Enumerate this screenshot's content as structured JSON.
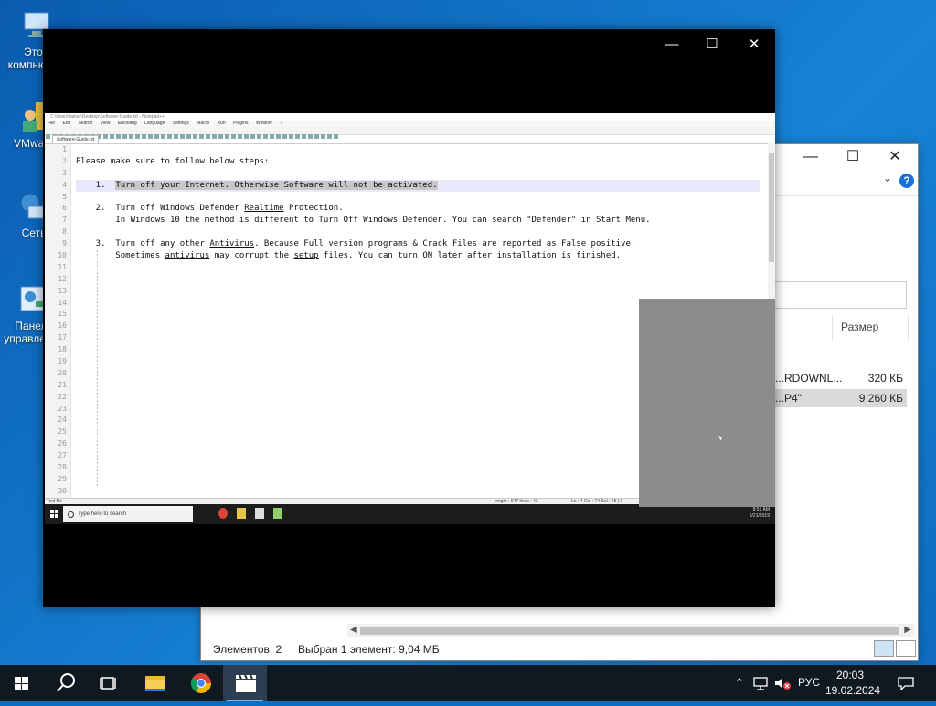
{
  "desktop": {
    "icons": [
      {
        "name": "this-pc",
        "label1": "Этот",
        "label2": "компьютер"
      },
      {
        "name": "vmware",
        "label1": "VMware",
        "label2": ""
      },
      {
        "name": "network",
        "label1": "Сеть",
        "label2": ""
      },
      {
        "name": "control-panel",
        "label1": "Панель",
        "label2": "управления"
      }
    ]
  },
  "explorer": {
    "column_size": "Размер",
    "rows": [
      {
        "name": "...RDOWNL...",
        "size": "320 КБ"
      },
      {
        "name": "...P4\"",
        "size": "9 260 КБ"
      }
    ],
    "status_items": "Элементов: 2",
    "status_selected": "Выбран 1 элемент: 9,04 МБ"
  },
  "player": {
    "notepad": {
      "title": "C:\\Users\\lamar\\Desktop\\Software-Guide.txt - Notepad++",
      "menu": [
        "File",
        "Edit",
        "Search",
        "View",
        "Encoding",
        "Language",
        "Settings",
        "Macro",
        "Run",
        "Plugins",
        "Window",
        "?"
      ],
      "tab": "Software-Guide.txt",
      "line_numbers": [
        "1",
        "2",
        "3",
        "4",
        "5",
        "6",
        "7",
        "8",
        "9",
        "10",
        "11",
        "12",
        "13",
        "14",
        "15",
        "16",
        "17",
        "18",
        "19",
        "20",
        "21",
        "22",
        "23",
        "24",
        "25",
        "26",
        "27",
        "28",
        "29",
        "30"
      ],
      "lines": {
        "l2": "Please make sure to follow below steps:",
        "l4_num": "    1.  ",
        "l4_text": "Turn off your Internet. Otherwise Software will not be activated.",
        "l6_a": "    2.  Turn off Windows Defender ",
        "l6_u": "Realtime",
        "l6_b": " Protection.",
        "l7": "        In Windows 10 the method is different to Turn Off Windows Defender. You can search \"Defender\" in Start Menu.",
        "l9_a": "    3.  Turn off any other ",
        "l9_u": "Antivirus",
        "l9_b": ". Because Full version programs & Crack Files are reported as False positive.",
        "l10_a": "        Sometimes ",
        "l10_u": "antivirus",
        "l10_b": " may corrupt the ",
        "l10_u2": "setup",
        "l10_c": " files. You can turn ON later after installation is finished."
      },
      "status_left": "Text file",
      "status_length": "length : 647    lines : 43",
      "status_pos": "Ln : 4    Col : 74    Sel : 65 | 0"
    },
    "inner_taskbar": {
      "search_placeholder": "Type here to search",
      "time": "8:51 AM",
      "date": "5/21/2019"
    }
  },
  "taskbar": {
    "language": "РУС",
    "time": "20:03",
    "date": "19.02.2024"
  }
}
